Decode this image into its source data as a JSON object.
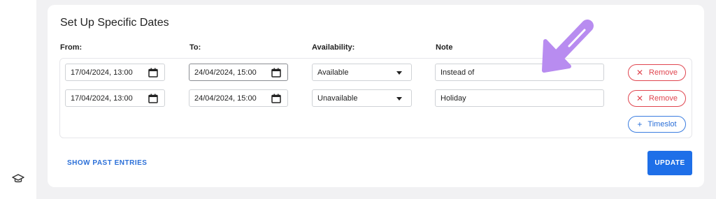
{
  "sidebar": {
    "icon": "graduation-cap-icon"
  },
  "section": {
    "title": "Set Up Specific Dates",
    "columns": {
      "from": "From:",
      "to": "To:",
      "availability": "Availability:",
      "note": "Note"
    }
  },
  "slots": [
    {
      "from": "17/04/2024, 13:00",
      "to": "24/04/2024, 15:00",
      "availability": "Available",
      "note": "Instead of",
      "remove_label": "Remove"
    },
    {
      "from": "17/04/2024, 13:00",
      "to": "24/04/2024, 15:00",
      "availability": "Unavailable",
      "note": "Holiday",
      "remove_label": "Remove"
    }
  ],
  "actions": {
    "add_timeslot": "Timeslot",
    "show_past": "SHOW PAST ENTRIES",
    "update": "UPDATE"
  },
  "icons": {
    "calendar": "calendar-icon",
    "remove": "close-icon",
    "add": "plus-icon",
    "annotation": "arrow-annotation-icon"
  },
  "colors": {
    "primary": "#1e6fe8",
    "danger": "#e0454f",
    "annotation": "#b88cf0"
  }
}
